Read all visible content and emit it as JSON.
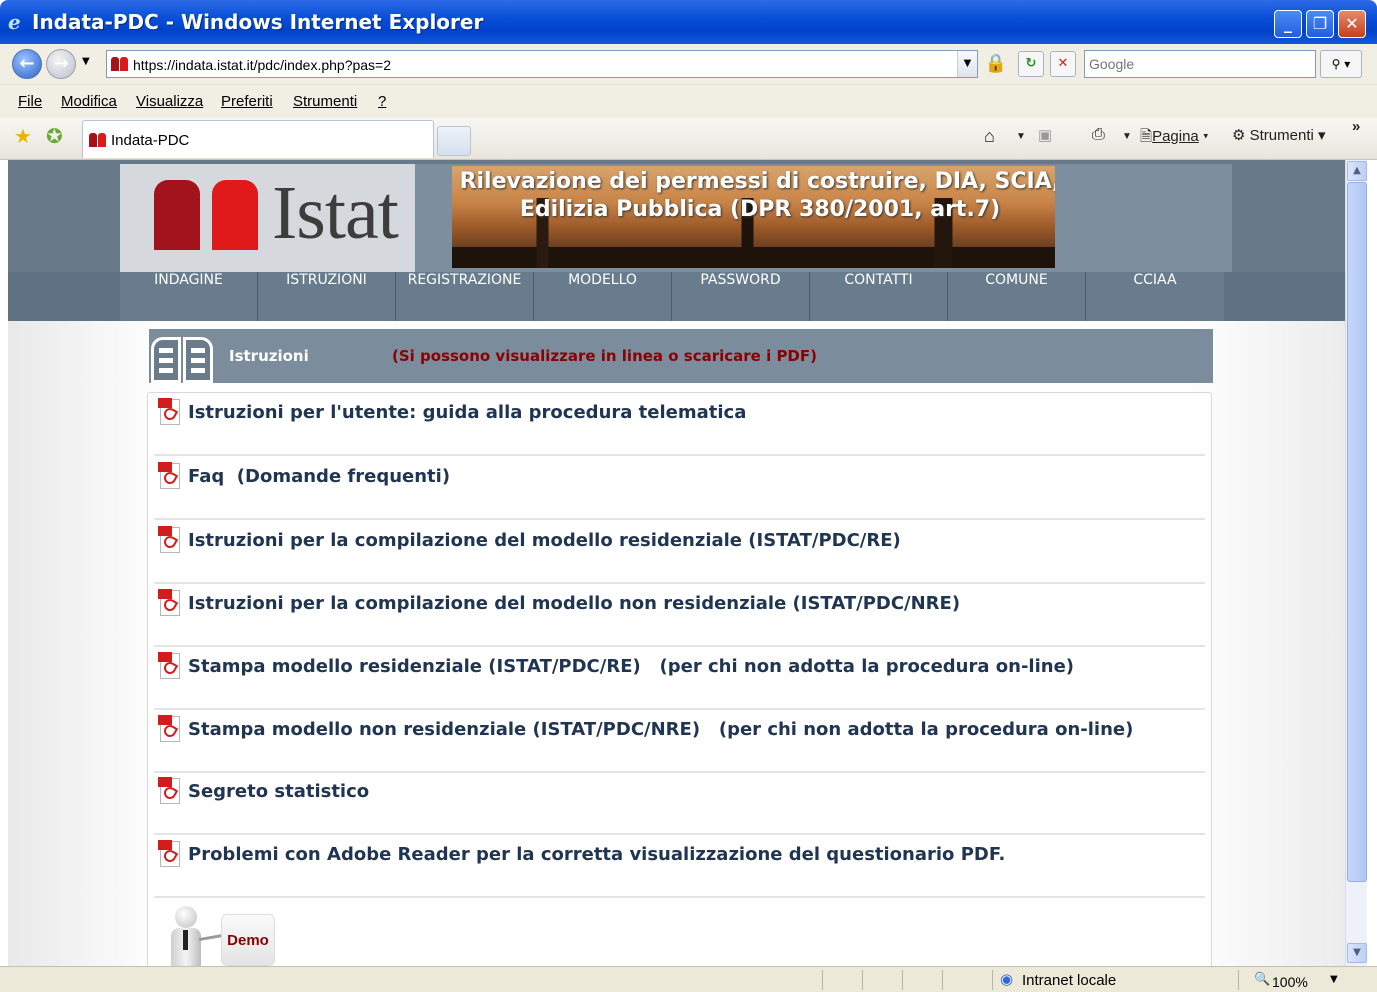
{
  "window": {
    "title": "Indata-PDC - Windows Internet Explorer",
    "buttons": {
      "minimize": "_",
      "maximize": "❐",
      "close": "✕"
    }
  },
  "addressbar": {
    "url": "https://indata.istat.it/pdc/index.php?pas=2",
    "search_placeholder": "Google"
  },
  "menu": {
    "file": "File",
    "edit": "Modifica",
    "view": "Visualizza",
    "favorites": "Preferiti",
    "tools": "Strumenti",
    "help": "?"
  },
  "tabbar": {
    "tab_label": "Indata-PDC",
    "page_label": "Pagina",
    "tools_label": "Strumenti",
    "more": "»"
  },
  "site": {
    "logo_text": "Istat",
    "banner_title": "Rilevazione dei permessi di costruire, DIA, SCIA, Edilizia Pubblica (DPR 380/2001, art.7)",
    "nav": [
      "INDAGINE",
      "ISTRUZIONI",
      "REGISTRAZIONE",
      "MODELLO",
      "PASSWORD",
      "CONTATTI",
      "COMUNE",
      "CCIAA"
    ],
    "section": {
      "title": "Istruzioni",
      "note": "(Si possono visualizzare in linea o scaricare i PDF)"
    },
    "items": [
      "Istruzioni per l'utente: guida alla procedura telematica",
      "Faq  (Domande frequenti)",
      "Istruzioni per la compilazione del modello residenziale (ISTAT/PDC/RE)",
      "Istruzioni per la compilazione del modello non residenziale (ISTAT/PDC/NRE)",
      "Stampa modello residenziale (ISTAT/PDC/RE)   (per chi non adotta la procedura on-line)",
      "Stampa modello non residenziale (ISTAT/PDC/NRE)   (per chi non adotta la procedura on-line)",
      "Segreto statistico",
      "Problemi con Adobe Reader per la corretta visualizzazione del questionario PDF."
    ],
    "demo_label": "Demo"
  },
  "statusbar": {
    "zone": "Intranet locale",
    "zoom": "100%"
  }
}
